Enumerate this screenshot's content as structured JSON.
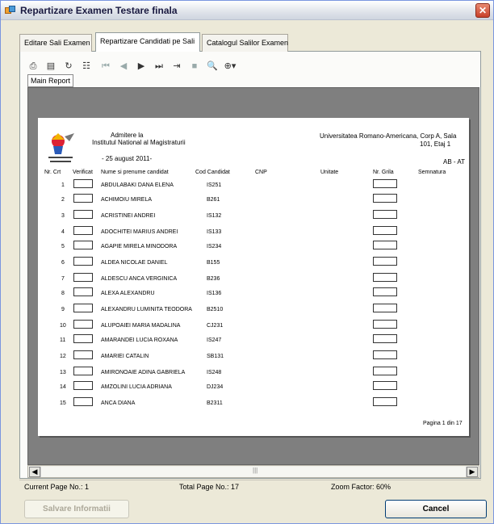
{
  "window": {
    "title": "Repartizare Examen Testare finala",
    "close_glyph": "✕"
  },
  "tabs": [
    "Editare Sali Examen",
    "Repartizare Candidati pe Sali",
    "Catalogul Salilor Examen"
  ],
  "toolbar": {
    "icons": [
      "export-icon",
      "print-icon",
      "refresh-icon",
      "tree-icon",
      "first-page-icon",
      "prev-page-icon",
      "next-page-icon",
      "last-page-icon",
      "goto-page-icon",
      "stop-icon",
      "search-icon",
      "zoom-icon"
    ]
  },
  "report_tab": "Main Report",
  "report": {
    "header": {
      "title_line1": "Admitere la",
      "title_line2": "Institutul National al Magistraturii",
      "date": "- 25 august 2011-",
      "university_line1": "Universitatea Romano-Americana, Corp A, Sala",
      "university_line2": "101, Etaj 1",
      "code": "AB - AT"
    },
    "columns": [
      "Nr. Crt",
      "Verificat",
      "Nume si prenume candidat",
      "Cod Candidat",
      "CNP",
      "Unitate",
      "Nr. Grila",
      "Semnatura"
    ],
    "rows": [
      {
        "nr": "1",
        "name": "ABDULABAKI DANA ELENA",
        "code": "IS251"
      },
      {
        "nr": "2",
        "name": "ACHIMOIU MIRELA",
        "code": "B261"
      },
      {
        "nr": "3",
        "name": "ACRISTINEI ANDREI",
        "code": "IS132"
      },
      {
        "nr": "4",
        "name": "ADOCHITEI MARIUS ANDREI",
        "code": "IS133"
      },
      {
        "nr": "5",
        "name": "AGAPIE MIRELA MINODORA",
        "code": "IS234"
      },
      {
        "nr": "6",
        "name": "ALDEA NICOLAE DANIEL",
        "code": "B155"
      },
      {
        "nr": "7",
        "name": "ALDESCU ANCA VERGINICA",
        "code": "B236"
      },
      {
        "nr": "8",
        "name": "ALEXA ALEXANDRU",
        "code": "IS136"
      },
      {
        "nr": "9",
        "name": "ALEXANDRU LUMINITA TEODORA",
        "code": "B2510"
      },
      {
        "nr": "10",
        "name": "ALUPOAIEI MARIA MADALINA",
        "code": "CJ231"
      },
      {
        "nr": "11",
        "name": "AMARANDEI LUCIA ROXANA",
        "code": "IS247"
      },
      {
        "nr": "12",
        "name": "AMARIEI CATALIN",
        "code": "SB131"
      },
      {
        "nr": "13",
        "name": "AMIRONOAIE ADINA GABRIELA",
        "code": "IS248"
      },
      {
        "nr": "14",
        "name": "AMZOLINI LUCIA ADRIANA",
        "code": "DJ234"
      },
      {
        "nr": "15",
        "name": "ANCA DIANA",
        "code": "B2311"
      }
    ],
    "page_of": "Pagina 1 din 17"
  },
  "status": {
    "current_page": "Current Page No.: 1",
    "total_pages": "Total Page No.: 17",
    "zoom": "Zoom Factor: 60%"
  },
  "buttons": {
    "save": "Salvare Informatii",
    "cancel": "Cancel"
  }
}
